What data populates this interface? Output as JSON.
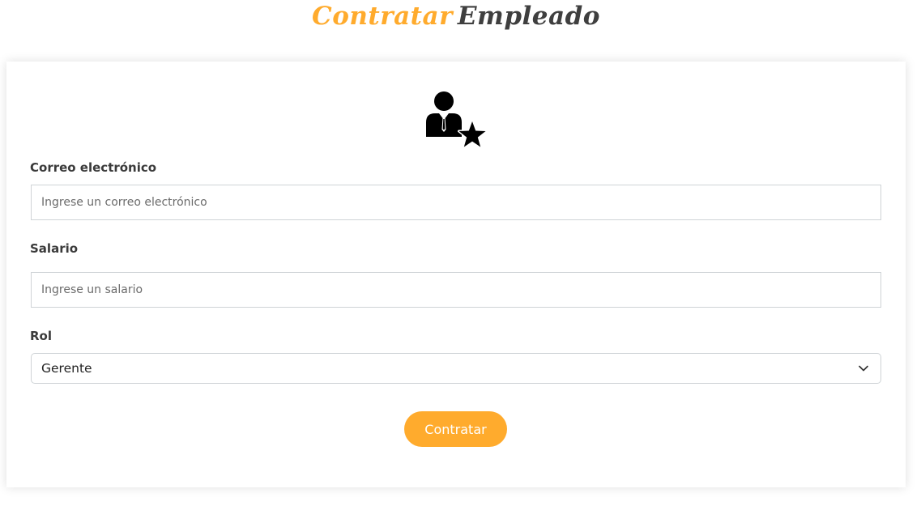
{
  "header": {
    "title_part1": "Contratar",
    "title_part2": "Empleado"
  },
  "form": {
    "icon": "employee-star-icon",
    "email": {
      "label": "Correo electrónico",
      "placeholder": "Ingrese un correo electrónico",
      "value": ""
    },
    "salary": {
      "label": "Salario",
      "placeholder": "Ingrese un salario",
      "value": ""
    },
    "role": {
      "label": "Rol",
      "selected": "Gerente",
      "icon": "chevron-down-icon"
    },
    "submit_label": "Contratar"
  },
  "colors": {
    "accent": "#ffab2d",
    "title_dark": "#3f3f3f",
    "label": "#3a3a3a",
    "border": "#cfd3d6"
  }
}
